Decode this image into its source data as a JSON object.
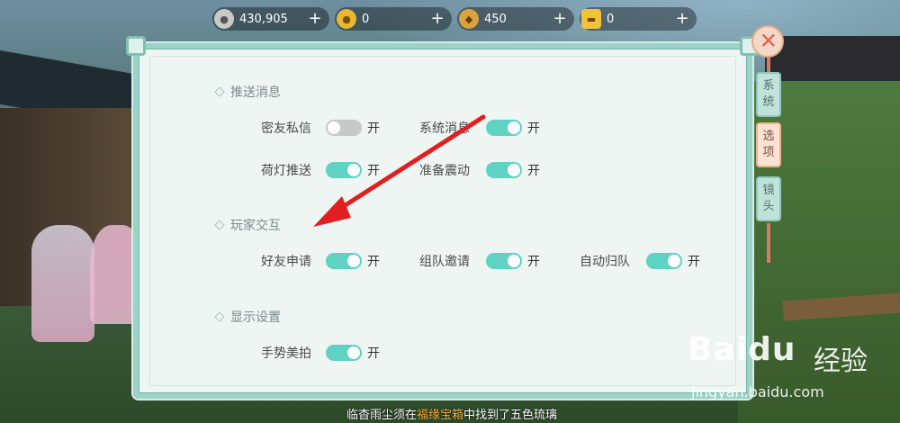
{
  "currencies": [
    {
      "icon": "silver-coin-icon",
      "value": "430,905"
    },
    {
      "icon": "gold-coin-icon",
      "value": "0"
    },
    {
      "icon": "pouch-icon",
      "value": "450"
    },
    {
      "icon": "gold-ingot-icon",
      "value": "0"
    }
  ],
  "plus_label": "+",
  "sections": {
    "push": {
      "title": "推送消息",
      "items": [
        {
          "label": "密友私信",
          "on": false,
          "state": "开"
        },
        {
          "label": "系统消息",
          "on": true,
          "state": "开"
        },
        {
          "label": "荷灯推送",
          "on": true,
          "state": "开"
        },
        {
          "label": "准备震动",
          "on": true,
          "state": "开"
        }
      ]
    },
    "interaction": {
      "title": "玩家交互",
      "items": [
        {
          "label": "好友申请",
          "on": true,
          "state": "开"
        },
        {
          "label": "组队邀请",
          "on": true,
          "state": "开"
        },
        {
          "label": "自动归队",
          "on": true,
          "state": "开"
        }
      ]
    },
    "display": {
      "title": "显示设置",
      "items": [
        {
          "label": "手势美拍",
          "on": true,
          "state": "开"
        }
      ]
    }
  },
  "side_tabs": {
    "close": "✕",
    "system": [
      "系",
      "统"
    ],
    "options": [
      "选",
      "项"
    ],
    "camera": [
      "镜",
      "头"
    ]
  },
  "ticker": {
    "prefix": "临杳雨尘须在",
    "highlight": "福缘宝箱",
    "suffix": "中找到了五色琉璃"
  },
  "watermark": {
    "brand": "Baidu",
    "cn": "经验",
    "url": "jingyan.baidu.com"
  },
  "colors": {
    "toggle_on": "#5fd2c3",
    "toggle_off": "#c8c8c8",
    "panel_border": "#9dd3c7",
    "arrow": "#e02020"
  }
}
